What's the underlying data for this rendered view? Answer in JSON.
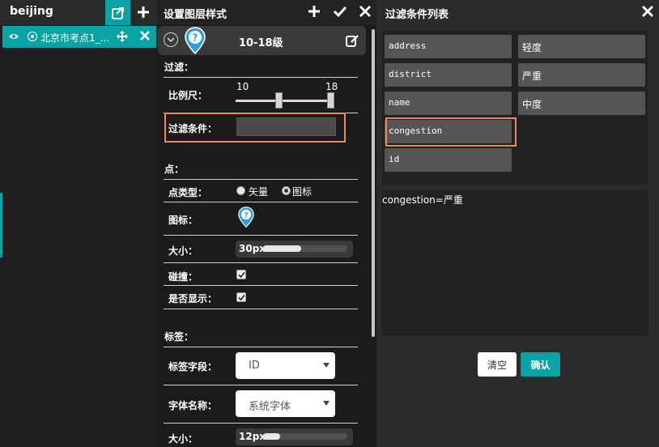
{
  "layer_panel": {
    "title": "beijing",
    "layer_item": {
      "name": "北京市考点1_..."
    }
  },
  "style_panel": {
    "title": "设置图层样式",
    "level_range": "10-18级",
    "filter_section": {
      "title": "过滤：",
      "scale_label": "比例尺：",
      "scale_min": "10",
      "scale_max": "18",
      "filter_label": "过滤条件：",
      "filter_value": ""
    },
    "point_section": {
      "title": "点：",
      "type_label": "点类型：",
      "type_options": [
        "矢量",
        "图标"
      ],
      "type_selected": "图标",
      "icon_label": "图标：",
      "size_label": "大小：",
      "size_value": "30px",
      "size_fraction": 0.45,
      "collision_label": "碰撞：",
      "collision_checked": true,
      "visible_label": "是否显示：",
      "visible_checked": true
    },
    "label_section": {
      "title": "标签：",
      "field_label": "标签字段：",
      "field_value": "ID",
      "font_label": "字体名称：",
      "font_value": "系统字体",
      "size_label": "大小：",
      "size_value": "12px",
      "size_fraction": 0.2
    }
  },
  "filter_panel": {
    "title": "过滤条件列表",
    "fields": [
      "address",
      "district",
      "name",
      "congestion",
      "id"
    ],
    "values": [
      "轻度",
      "严重",
      "中度"
    ],
    "expression": "congestion=严重",
    "clear_label": "清空",
    "confirm_label": "确认"
  },
  "colors": {
    "accent": "#0aa3a5",
    "highlight": "#f2875b",
    "panel_dark": "#1b1b1b",
    "chip": "#555555"
  },
  "icons": [
    "share-icon",
    "plus-icon",
    "eye-icon",
    "move-icon",
    "close-icon",
    "check-icon",
    "chevron-down-icon",
    "map-pin-icon",
    "edit-icon"
  ]
}
